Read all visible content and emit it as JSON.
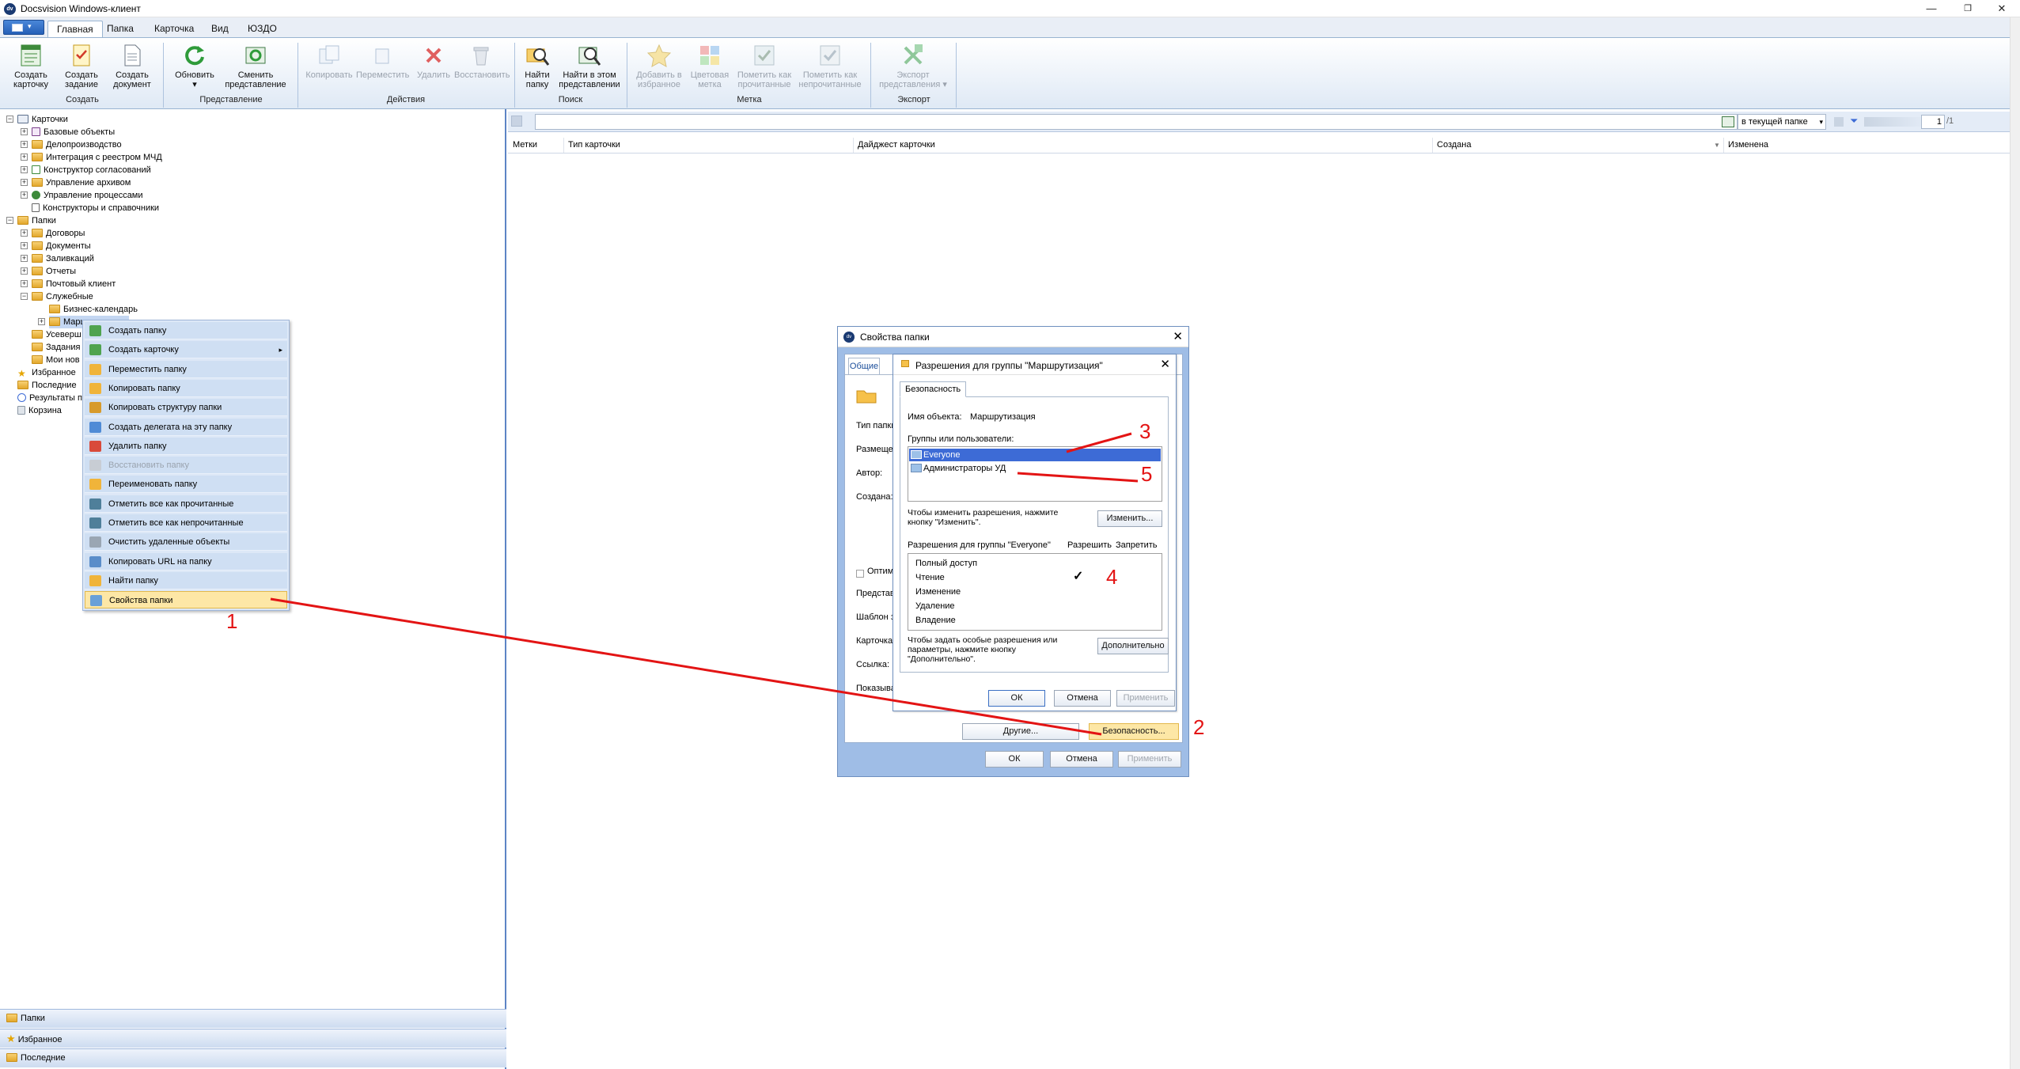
{
  "window": {
    "title": "Docsvision Windows-клиент",
    "minimize": "—",
    "restore": "❐",
    "close": "✕"
  },
  "ribbon": {
    "tabs": [
      "Главная",
      "Папка",
      "Карточка",
      "Вид",
      "ЮЗДО"
    ],
    "buttons": {
      "create_card": "Создать карточку",
      "create_task": "Создать задание",
      "create_doc": "Создать документ",
      "refresh": "Обновить",
      "change_view": "Сменить представление",
      "copy": "Копировать",
      "move": "Переместить",
      "delete": "Удалить",
      "restore": "Восстановить",
      "find_folder": "Найти папку",
      "find_in_view": "Найти в этом представлении",
      "add_fav": "Добавить в избранное",
      "color_mark": "Цветовая метка",
      "mark_read": "Пометить как прочитанные",
      "mark_unread": "Пометить как непрочитанные",
      "export_view": "Экспорт представления"
    },
    "groups": [
      "Создать",
      "Представление",
      "Действия",
      "Поиск",
      "Метка",
      "Экспорт"
    ]
  },
  "tree": {
    "nodes": [
      {
        "label": "Карточки",
        "level": 0,
        "exp": "−",
        "icon": "cards"
      },
      {
        "label": "Базовые объекты",
        "level": 1,
        "exp": "+",
        "icon": "base"
      },
      {
        "label": "Делопроизводство",
        "level": 1,
        "exp": "+",
        "icon": "folder"
      },
      {
        "label": "Интеграция с реестром МЧД",
        "level": 1,
        "exp": "+",
        "icon": "folder"
      },
      {
        "label": "Конструктор согласований",
        "level": 1,
        "exp": "+",
        "icon": "check"
      },
      {
        "label": "Управление архивом",
        "level": 1,
        "exp": "+",
        "icon": "folder"
      },
      {
        "label": "Управление процессами",
        "level": 1,
        "exp": "+",
        "icon": "gear"
      },
      {
        "label": "Конструкторы и справочники",
        "level": 1,
        "exp": "",
        "icon": "book"
      },
      {
        "label": "Папки",
        "level": 0,
        "exp": "−",
        "icon": "folder"
      },
      {
        "label": "Договоры",
        "level": 1,
        "exp": "+",
        "icon": "folder"
      },
      {
        "label": "Документы",
        "level": 1,
        "exp": "+",
        "icon": "folder"
      },
      {
        "label": "Заливкаций",
        "level": 1,
        "exp": "+",
        "icon": "folder"
      },
      {
        "label": "Отчеты",
        "level": 1,
        "exp": "+",
        "icon": "folder"
      },
      {
        "label": "Почтовый клиент",
        "level": 1,
        "exp": "+",
        "icon": "folder"
      },
      {
        "label": "Служебные",
        "level": 1,
        "exp": "−",
        "icon": "folder"
      },
      {
        "label": "Бизнес-календарь",
        "level": 2,
        "exp": "",
        "icon": "folder"
      },
      {
        "label": "Маршрутизация",
        "level": 2,
        "exp": "+",
        "icon": "folder"
      },
      {
        "label": "Усеверш",
        "level": 1,
        "exp": "",
        "icon": "folder"
      },
      {
        "label": "Задания",
        "level": 1,
        "exp": "",
        "icon": "folder"
      },
      {
        "label": "Мои нов",
        "level": 1,
        "exp": "",
        "icon": "folder"
      },
      {
        "label": "Избранное",
        "level": 0,
        "exp": "",
        "icon": "star"
      },
      {
        "label": "Последние",
        "level": 0,
        "exp": "",
        "icon": "folder"
      },
      {
        "label": "Результаты п",
        "level": 0,
        "exp": "",
        "icon": "search"
      },
      {
        "label": "Корзина",
        "level": 0,
        "exp": "",
        "icon": "bin"
      }
    ]
  },
  "nav_panes": [
    "Папки",
    "Избранное",
    "Последние"
  ],
  "search": {
    "scope": "в текущей папке",
    "page": "1",
    "page_total": "/1"
  },
  "columns": [
    "Метки",
    "Тип карточки",
    "Дайджест карточки",
    "Создана",
    "Изменена"
  ],
  "context_menu": [
    {
      "label": "Создать папку",
      "disabled": false,
      "icon": "new-folder"
    },
    {
      "label": "Создать карточку",
      "disabled": false,
      "icon": "new-card",
      "submenu": "▸"
    },
    {
      "label": "Переместить папку",
      "disabled": false,
      "icon": "move-folder"
    },
    {
      "label": "Копировать папку",
      "disabled": false,
      "icon": "copy-folder"
    },
    {
      "label": "Копировать структуру папки",
      "disabled": false,
      "icon": "copy-structure"
    },
    {
      "label": "Создать делегата на эту папку",
      "disabled": false,
      "icon": "delegate"
    },
    {
      "label": "Удалить папку",
      "disabled": false,
      "icon": "delete-folder"
    },
    {
      "label": "Восстановить папку",
      "disabled": true,
      "icon": "restore-folder"
    },
    {
      "label": "Переименовать папку",
      "disabled": false,
      "icon": "rename"
    },
    {
      "label": "Отметить все как прочитанные",
      "disabled": false,
      "icon": "mark-read"
    },
    {
      "label": "Отметить все как непрочитанные",
      "disabled": false,
      "icon": "mark-unread"
    },
    {
      "label": "Очистить удаленные объекты",
      "disabled": false,
      "icon": "clean"
    },
    {
      "label": "Копировать URL на папку",
      "disabled": false,
      "icon": "copy-url"
    },
    {
      "label": "Найти папку",
      "disabled": false,
      "icon": "find"
    },
    {
      "label": "Свойства папки",
      "disabled": false,
      "highlight": true,
      "icon": "properties"
    }
  ],
  "folder_props": {
    "title": "Свойства папки",
    "tab_general": "Общие",
    "labels": [
      "Тип папки",
      "Размещен",
      "Автор:",
      "Создана:",
      "Оптим",
      "Представ",
      "Шаблон з",
      "Карточка",
      "Ссылка:",
      "Показыва"
    ],
    "others_button": "Другие...",
    "security_button": "Безопасность...",
    "ok": "ОК",
    "cancel": "Отмена",
    "apply": "Применить"
  },
  "permissions": {
    "title": "Разрешения для группы \"Маршрутизация\"",
    "tab": "Безопасность",
    "object_name_label": "Имя объекта:",
    "object_name": "Маршрутизация",
    "groups_label": "Группы или пользователи:",
    "groups": [
      "Everyone",
      "Администраторы УД"
    ],
    "change_hint": "Чтобы изменить разрешения, нажмите кнопку \"Изменить\".",
    "change_button": "Изменить...",
    "perm_header": "Разрешения для группы \"Everyone\"",
    "allow": "Разрешить",
    "deny": "Запретить",
    "perms": [
      "Полный доступ",
      "Чтение",
      "Изменение",
      "Удаление",
      "Владение"
    ],
    "allowed_mark": "✓",
    "special_hint": "Чтобы задать особые разрешения или параметры, нажмите кнопку \"Дополнительно\".",
    "advanced_button": "Дополнительно",
    "ok": "ОК",
    "cancel": "Отмена",
    "apply": "Применить"
  },
  "annotations": [
    "1",
    "2",
    "3",
    "4",
    "5"
  ],
  "colors": {
    "annotation": "#e31414",
    "selection": "#3d6bd6",
    "highlight": "#fde7a6"
  }
}
